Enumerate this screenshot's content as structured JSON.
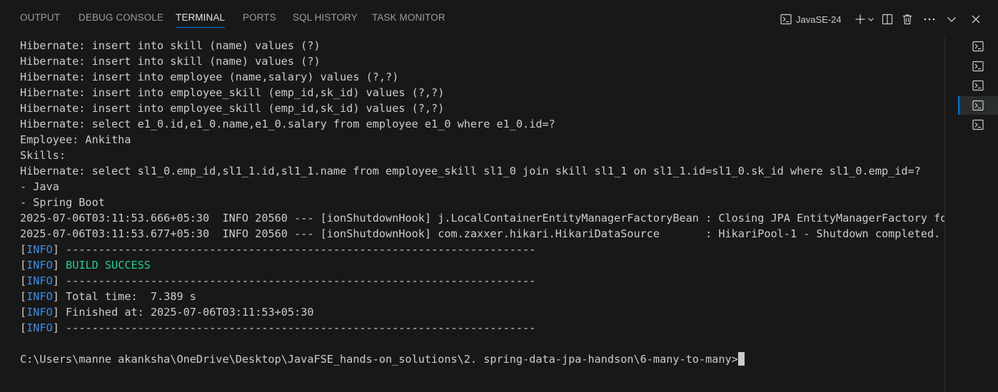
{
  "panel": {
    "tabs": [
      {
        "label": "OUTPUT"
      },
      {
        "label": "DEBUG CONSOLE"
      },
      {
        "label": "TERMINAL"
      },
      {
        "label": "PORTS"
      },
      {
        "label": "SQL HISTORY"
      },
      {
        "label": "TASK MONITOR"
      }
    ],
    "active_tab": "TERMINAL",
    "terminal_profile": "JavaSE-24",
    "accent_color": "#0078d4"
  },
  "terminal": {
    "lines": [
      {
        "kind": "plain",
        "text": "Hibernate: insert into skill (name) values (?)"
      },
      {
        "kind": "plain",
        "text": "Hibernate: insert into skill (name) values (?)"
      },
      {
        "kind": "plain",
        "text": "Hibernate: insert into employee (name,salary) values (?,?)"
      },
      {
        "kind": "plain",
        "text": "Hibernate: insert into employee_skill (emp_id,sk_id) values (?,?)"
      },
      {
        "kind": "plain",
        "text": "Hibernate: insert into employee_skill (emp_id,sk_id) values (?,?)"
      },
      {
        "kind": "plain",
        "text": "Hibernate: select e1_0.id,e1_0.name,e1_0.salary from employee e1_0 where e1_0.id=?"
      },
      {
        "kind": "plain",
        "text": "Employee: Ankitha"
      },
      {
        "kind": "plain",
        "text": "Skills:"
      },
      {
        "kind": "plain",
        "text": "Hibernate: select sl1_0.emp_id,sl1_1.id,sl1_1.name from employee_skill sl1_0 join skill sl1_1 on sl1_1.id=sl1_0.sk_id where sl1_0.emp_id=?"
      },
      {
        "kind": "plain",
        "text": "- Java"
      },
      {
        "kind": "plain",
        "text": "- Spring Boot"
      },
      {
        "kind": "plain",
        "text": "2025-07-06T03:11:53.666+05:30  INFO 20560 --- [ionShutdownHook] j.LocalContainerEntityManagerFactoryBean : Closing JPA EntityManagerFactory for"
      },
      {
        "kind": "plain",
        "text": "2025-07-06T03:11:53.677+05:30  INFO 20560 --- [ionShutdownHook] com.zaxxer.hikari.HikariDataSource       : HikariPool-1 - Shutdown completed."
      },
      {
        "kind": "info",
        "tag": "INFO",
        "text": " ------------------------------------------------------------------------"
      },
      {
        "kind": "info",
        "tag": "INFO",
        "text": " ",
        "success": "BUILD SUCCESS"
      },
      {
        "kind": "info",
        "tag": "INFO",
        "text": " ------------------------------------------------------------------------"
      },
      {
        "kind": "info",
        "tag": "INFO",
        "text": " Total time:  7.389 s"
      },
      {
        "kind": "info",
        "tag": "INFO",
        "text": " Finished at: 2025-07-06T03:11:53+05:30"
      },
      {
        "kind": "info",
        "tag": "INFO",
        "text": " ------------------------------------------------------------------------"
      },
      {
        "kind": "plain",
        "text": ""
      },
      {
        "kind": "prompt",
        "text": "C:\\Users\\manne akanksha\\OneDrive\\Desktop\\JavaFSE_hands-on_solutions\\2. spring-data-jpa-handson\\6-many-to-many>"
      }
    ],
    "colors": {
      "info": "#3b8eea",
      "success": "#23d18b",
      "text": "#cccccc",
      "background": "#181818"
    }
  },
  "sidebar_terminals": [
    {
      "icon": "terminal-icon",
      "active": false
    },
    {
      "icon": "terminal-icon",
      "active": false
    },
    {
      "icon": "terminal-icon",
      "active": false
    },
    {
      "icon": "terminal-icon",
      "active": true
    },
    {
      "icon": "terminal-icon",
      "active": false
    }
  ]
}
